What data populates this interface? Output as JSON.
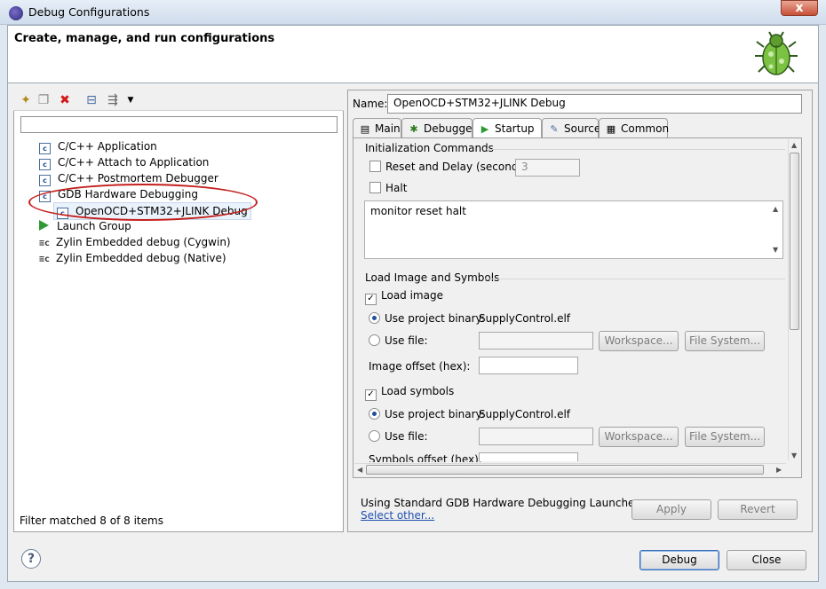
{
  "window": {
    "title": "Debug Configurations",
    "close_glyph": "x"
  },
  "header": {
    "title": "Create, manage, and run configurations",
    "icon": "debug-bug-icon"
  },
  "left": {
    "toolbar_icons": [
      "new-configuration-icon",
      "duplicate-icon",
      "delete-icon",
      "collapse-all-icon",
      "filter-icon",
      "dropdown-arrow-icon"
    ],
    "filter_placeholder": "",
    "tree": [
      {
        "label": "C/C++ Application",
        "icon": "c-config-icon",
        "level": 0
      },
      {
        "label": "C/C++ Attach to Application",
        "icon": "c-config-icon",
        "level": 0
      },
      {
        "label": "C/C++ Postmortem Debugger",
        "icon": "c-config-icon",
        "level": 0
      },
      {
        "label": "GDB Hardware Debugging",
        "icon": "c-config-icon",
        "level": 0
      },
      {
        "label": "OpenOCD+STM32+JLINK Debug",
        "icon": "c-config-icon",
        "level": 1,
        "selected": true
      },
      {
        "label": "Launch Group",
        "icon": "launch-group-icon",
        "level": 0
      },
      {
        "label": "Zylin Embedded debug (Cygwin)",
        "icon": "zylin-icon",
        "level": 0
      },
      {
        "label": "Zylin Embedded debug (Native)",
        "icon": "zylin-icon",
        "level": 0
      }
    ],
    "status": "Filter matched 8 of 8 items",
    "annotation_color": "#c3201e"
  },
  "right": {
    "name_label": "Name:",
    "name_value": "OpenOCD+STM32+JLINK Debug",
    "tabs": [
      {
        "label": "Main",
        "icon": "main-tab-icon"
      },
      {
        "label": "Debugger",
        "icon": "debugger-tab-icon"
      },
      {
        "label": "Startup",
        "icon": "startup-tab-icon",
        "active": true
      },
      {
        "label": "Source",
        "icon": "source-tab-icon"
      },
      {
        "label": "Common",
        "icon": "common-tab-icon"
      }
    ],
    "init": {
      "group_label": "Initialization Commands",
      "reset_label": "Reset and Delay (seconds):",
      "reset_checked": false,
      "delay_value": "3",
      "halt_label": "Halt",
      "halt_checked": false,
      "commands": "monitor reset halt"
    },
    "load": {
      "group_label": "Load Image and Symbols",
      "load_image_label": "Load image",
      "load_image_checked": true,
      "use_project_binary_label": "Use project binary:",
      "project_binary_value": "SupplyControl.elf",
      "use_file_label": "Use file:",
      "workspace_label": "Workspace...",
      "filesystem_label": "File System...",
      "image_offset_label": "Image offset (hex):",
      "load_symbols_label": "Load symbols",
      "load_symbols_checked": true,
      "symbols_project_binary_value": "SupplyControl.elf",
      "symbols_offset_label": "Symbols offset (hex):"
    },
    "launcher_text": "Using Standard GDB Hardware Debugging Launcher -",
    "select_other": "Select other...",
    "apply_label": "Apply",
    "revert_label": "Revert"
  },
  "footer": {
    "help_glyph": "?",
    "debug_label": "Debug",
    "close_label": "Close"
  }
}
